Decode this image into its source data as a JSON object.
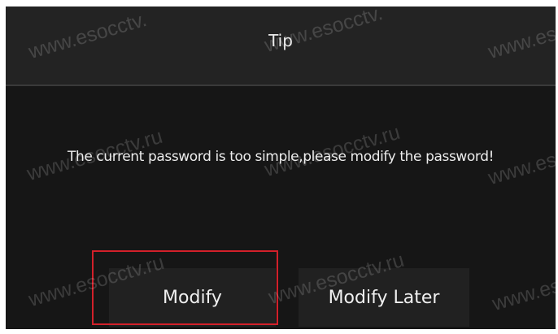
{
  "dialog": {
    "title": "Tip",
    "message": "The current password is too simple,please modify the password!",
    "buttons": {
      "modify": "Modify",
      "modify_later": "Modify Later"
    },
    "highlighted_button": "Modify"
  },
  "watermark": {
    "text_main": "www.esocctv.",
    "text_suffix": "ru"
  },
  "colors": {
    "dialog_background": "#161616",
    "title_bar_background": "#232323",
    "button_background": "#212121",
    "highlight_border": "#d2202a"
  }
}
